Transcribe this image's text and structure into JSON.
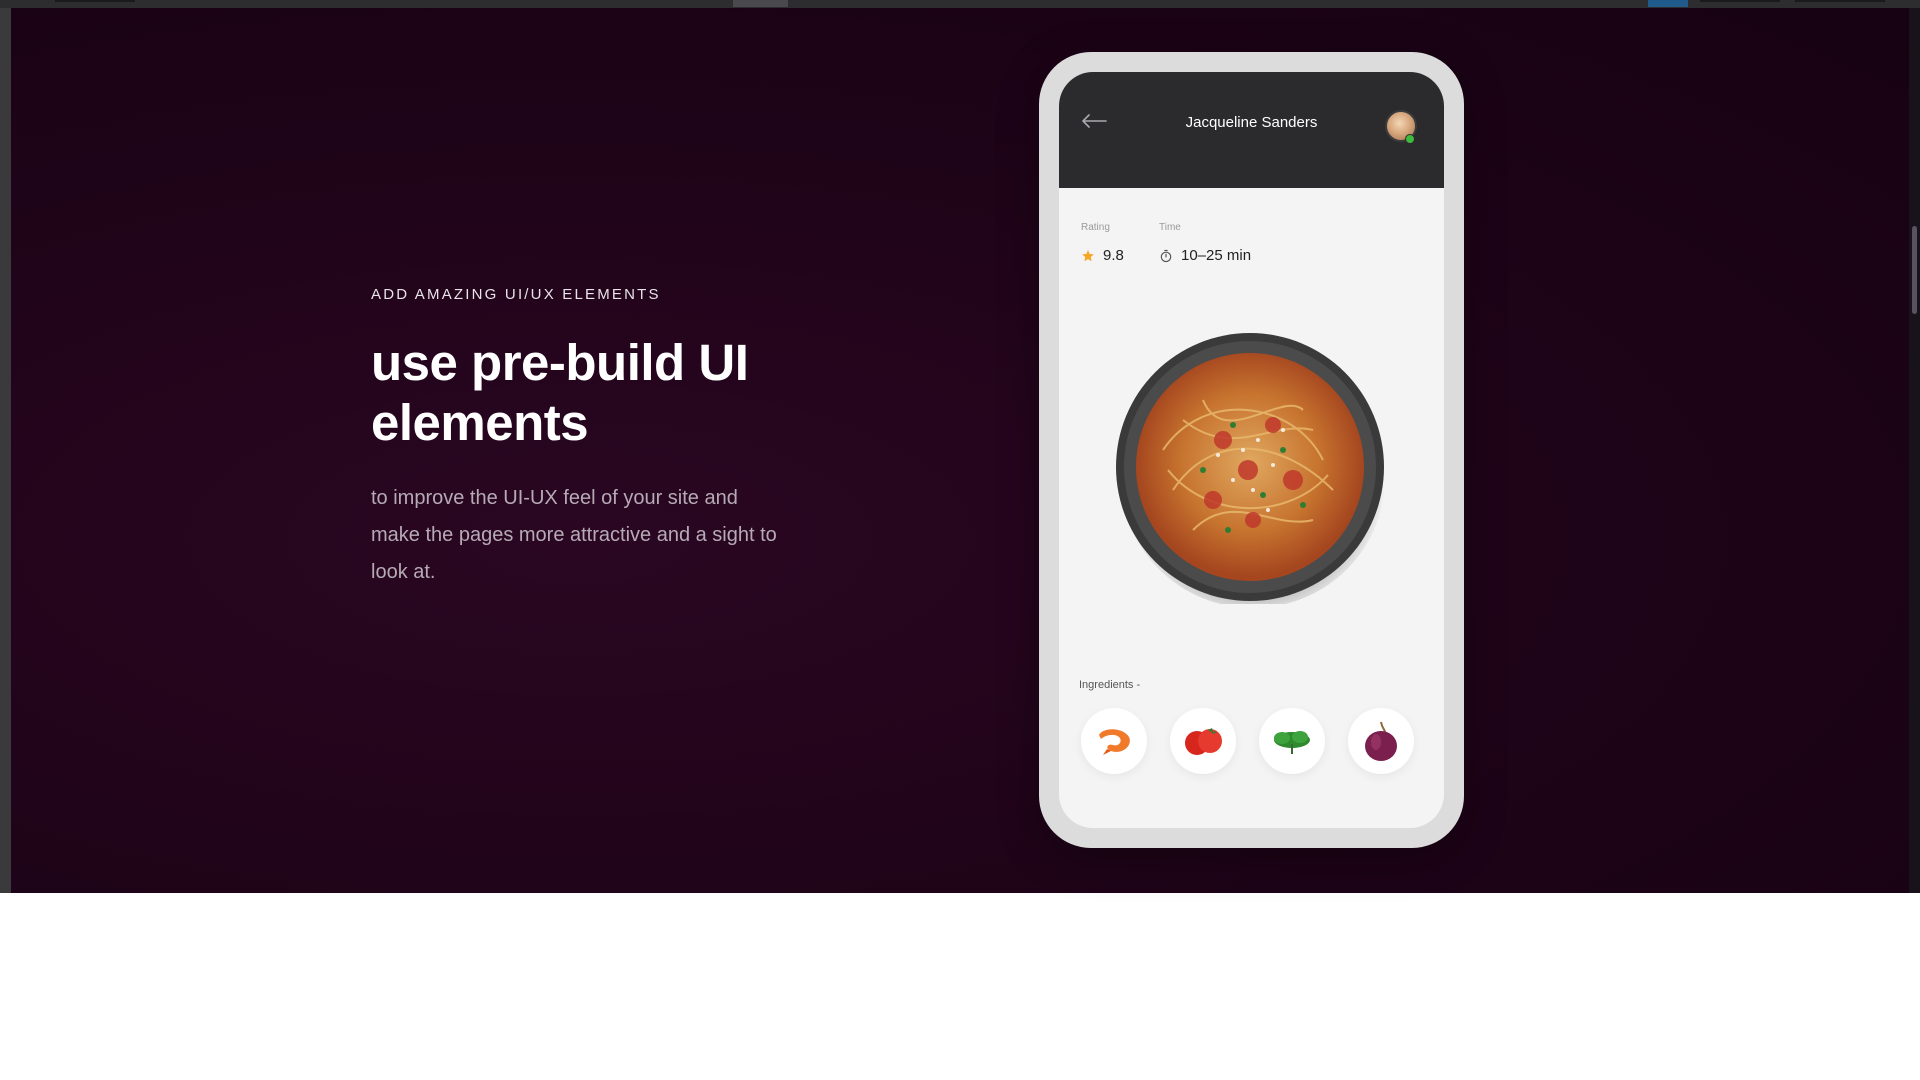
{
  "hero": {
    "eyebrow": "ADD AMAZING UI/UX ELEMENTS",
    "headline": "use pre-build UI elements",
    "body": "to improve the UI-UX feel of your site and make the pages more attractive and a sight to look at."
  },
  "phone": {
    "header": {
      "user_name": "Jacqueline Sanders",
      "online": true
    },
    "stats": {
      "rating_label": "Rating",
      "rating_value": "9.8",
      "time_label": "Time",
      "time_value": "10–25 min"
    },
    "ingredients_label": "Ingredients  -",
    "ingredients": [
      {
        "icon": "shrimp-icon"
      },
      {
        "icon": "tomato-icon"
      },
      {
        "icon": "parsley-icon"
      },
      {
        "icon": "onion-icon"
      }
    ]
  },
  "colors": {
    "hero_bg": "#200419",
    "accent_star": "#f5a623",
    "online_dot": "#3dbb3d"
  }
}
